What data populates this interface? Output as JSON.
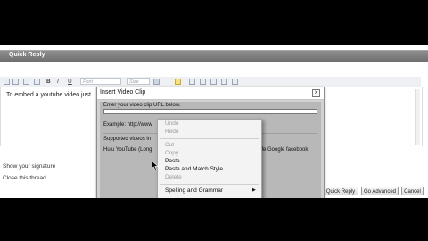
{
  "quick_reply": {
    "title": "Quick Reply"
  },
  "toolbar": {
    "font_placeholder": "Font",
    "size_placeholder": "Size",
    "bold": "B",
    "italic": "I",
    "underline": "U"
  },
  "editor": {
    "text": "To embed a youtube video just"
  },
  "options": {
    "show_signature": "Show your signature",
    "close_thread": "Close this thread"
  },
  "buttons": {
    "quick_reply": "Quick Reply",
    "go_advanced": "Go Advanced",
    "cancel": "Cancel"
  },
  "dialog": {
    "title": "Insert Video Clip",
    "close": "x",
    "url_label": "Enter your video clip URL below.",
    "example": "Example: http://www",
    "supported": "Supported videos in",
    "providers_left": "Hulu YouTube (Long",
    "providers_right": "ife Google facebook"
  },
  "context_menu": {
    "undo": "Undo",
    "redo": "Redo",
    "cut": "Cut",
    "copy": "Copy",
    "paste": "Paste",
    "paste_match": "Paste and Match Style",
    "delete": "Delete",
    "spelling": "Spelling and Grammar",
    "submenu_arrow": "▶"
  }
}
